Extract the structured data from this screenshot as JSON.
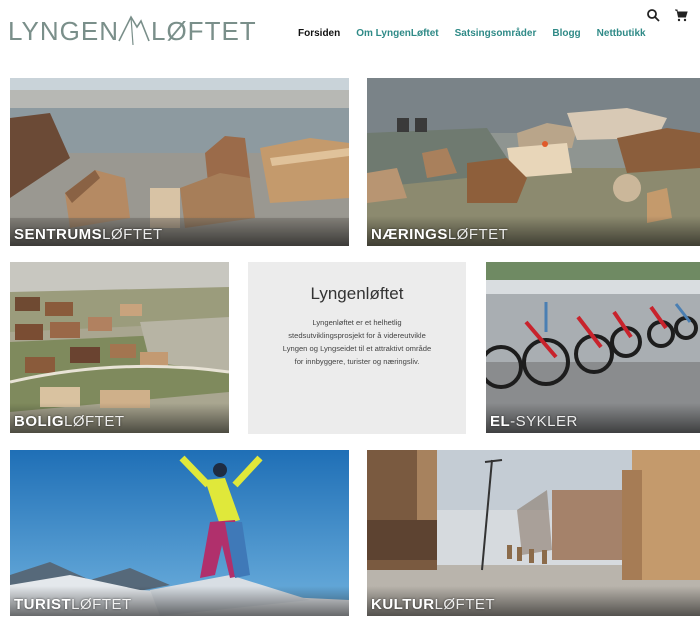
{
  "header": {
    "logo_left": "LYNGEN",
    "logo_right": "LØFTET",
    "nav": [
      {
        "label": "Forsiden",
        "active": true
      },
      {
        "label": "Om LyngenLøftet",
        "active": false
      },
      {
        "label": "Satsingsområder",
        "active": false
      },
      {
        "label": "Blogg",
        "active": false
      },
      {
        "label": "Nettbutikk",
        "active": false
      }
    ],
    "icons": [
      "search-icon",
      "cart-icon"
    ]
  },
  "tiles": [
    {
      "bold": "SENTRUMS",
      "light": "LØFTET"
    },
    {
      "bold": "NÆRINGS",
      "light": "LØFTET"
    },
    {
      "bold": "BOLIG",
      "light": "LØFTET"
    },
    {
      "bold": "EL",
      "light": "-SYKLER"
    },
    {
      "bold": "TURIST",
      "light": "LØFTET"
    },
    {
      "bold": "KULTUR",
      "light": "LØFTET"
    }
  ],
  "info": {
    "title": "Lyngenløftet",
    "body": "Lyngenløftet er et helhetlig stedsutviklingsprosjekt for å videreutvikle Lyngen og Lyngseidet til et attraktivt område for innbyggere, turister og næringsliv."
  },
  "colors": {
    "accent": "#2f8a87",
    "logo": "#7a8f8a",
    "info_bg": "#ececec"
  }
}
